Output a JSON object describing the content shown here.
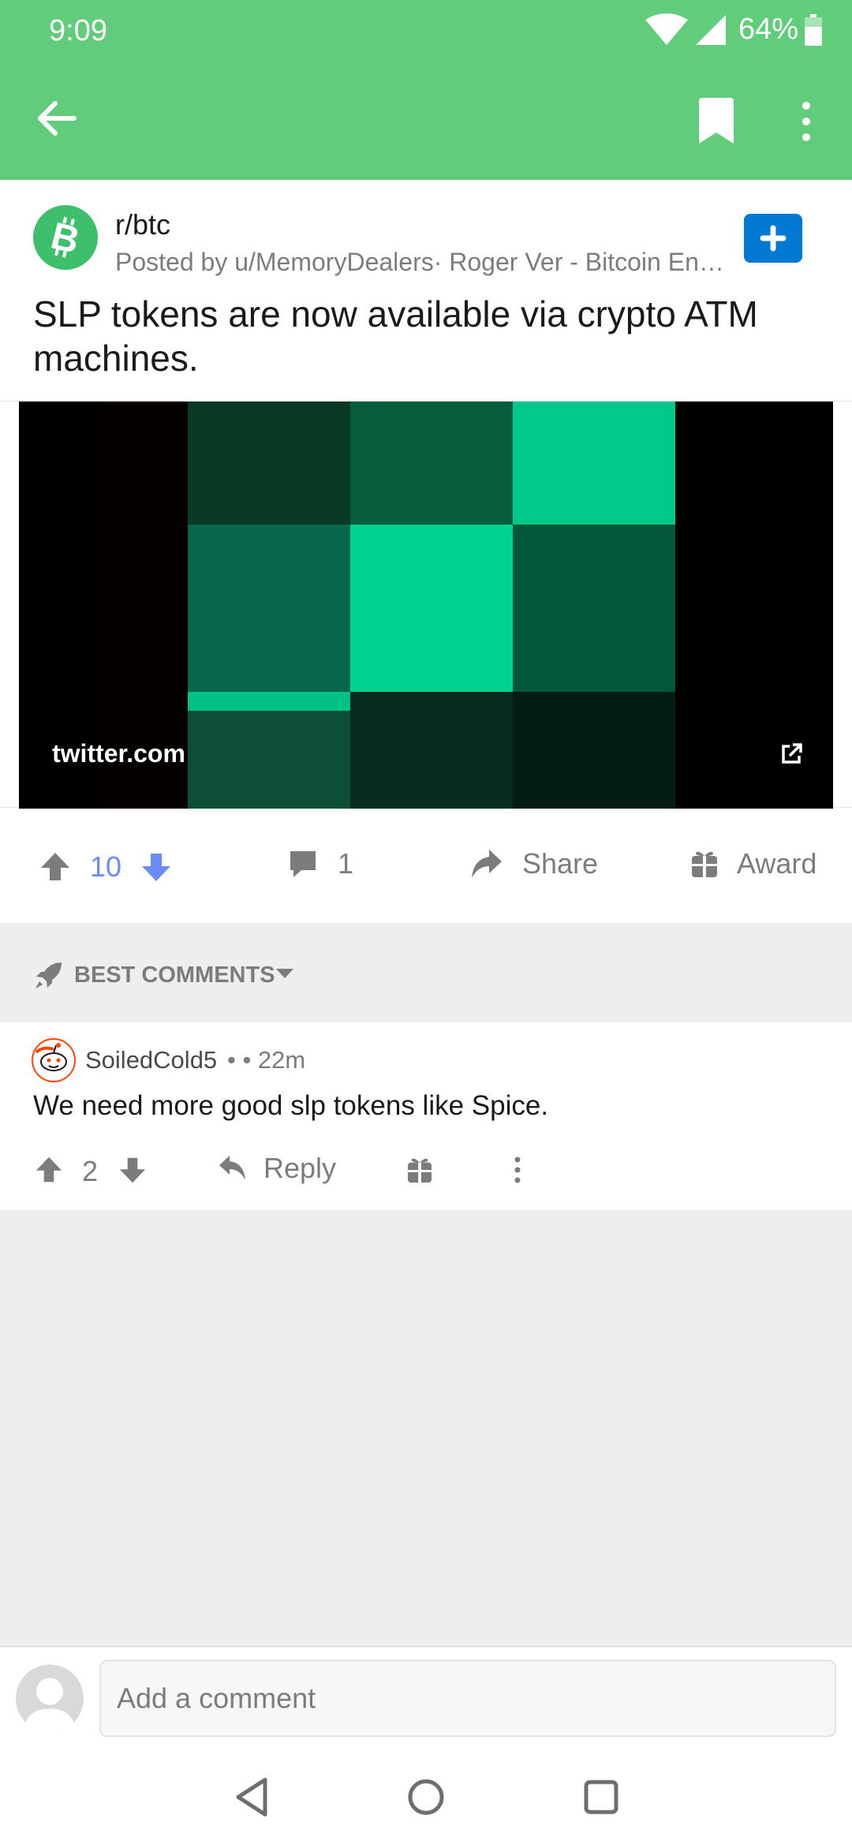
{
  "status": {
    "time": "9:09",
    "battery": "64%"
  },
  "post": {
    "subreddit": "r/btc",
    "posted_by": "Posted by u/MemoryDealers· Roger Ver - Bitcoin Entr...",
    "title": "SLP tokens are now available via crypto ATM machines.",
    "link_domain": "twitter.com",
    "votes": "10",
    "comments_count": "1",
    "share_label": "Share",
    "award_label": "Award"
  },
  "sort": {
    "label": "BEST COMMENTS"
  },
  "comment": {
    "author": "SoiledCold5",
    "time": "•  • 22m",
    "body": "We need more good slp tokens like Spice.",
    "votes": "2",
    "reply_label": "Reply"
  },
  "composer": {
    "placeholder": "Add a comment"
  },
  "colors": {
    "appbar": "#61cc7a",
    "upvoted": "#6a8cf5",
    "join": "#0079d3",
    "subreddit_icon": "#3ebf6b"
  }
}
